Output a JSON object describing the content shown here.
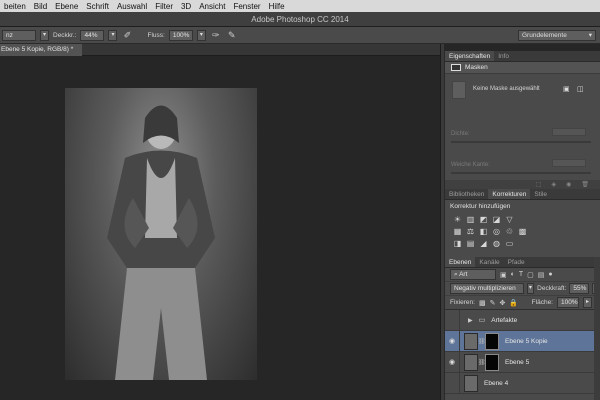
{
  "menubar": {
    "items": [
      "beiten",
      "Bild",
      "Ebene",
      "Schrift",
      "Auswahl",
      "Filter",
      "3D",
      "Ansicht",
      "Fenster",
      "Hilfe"
    ]
  },
  "titlebar": {
    "title": "Adobe Photoshop CC 2014"
  },
  "options": {
    "mode_value": "nz",
    "opacity_label": "Deckkr.:",
    "opacity_value": "44%",
    "flow_label": "Fluss:",
    "flow_value": "100%",
    "workspace": "Grundelemente"
  },
  "document": {
    "tab_title": "Ebene 5 Kopie, RGB/8) *"
  },
  "properties": {
    "tabs": [
      "Eigenschaften",
      "Info"
    ],
    "section": "Masken",
    "no_mask": "Keine Maske ausgewählt",
    "density_label": "Dichte:",
    "feather_label": "Weiche Kante:"
  },
  "adjustments": {
    "tabs": [
      "Bibliotheken",
      "Korrekturen",
      "Stile"
    ],
    "title": "Korrektur hinzufügen"
  },
  "layers": {
    "tabs": [
      "Ebenen",
      "Kanäle",
      "Pfade"
    ],
    "filter": "Art",
    "blend_mode": "Negativ multiplizieren",
    "opacity_label": "Deckkraft:",
    "opacity_value": "55%",
    "lock_label": "Fixieren:",
    "fill_label": "Fläche:",
    "fill_value": "100%",
    "items": [
      {
        "name": "Artefakte",
        "type": "group",
        "visible": false,
        "selected": false
      },
      {
        "name": "Ebene 5 Kopie",
        "type": "layer-mask",
        "visible": true,
        "selected": true
      },
      {
        "name": "Ebene 5",
        "type": "layer-mask",
        "visible": true,
        "selected": false
      },
      {
        "name": "Ebene 4",
        "type": "layer",
        "visible": false,
        "selected": false
      }
    ]
  },
  "colors": {
    "selected_layer": "#5e7498",
    "panel": "#4a4a4a",
    "canvas": "#262626"
  }
}
